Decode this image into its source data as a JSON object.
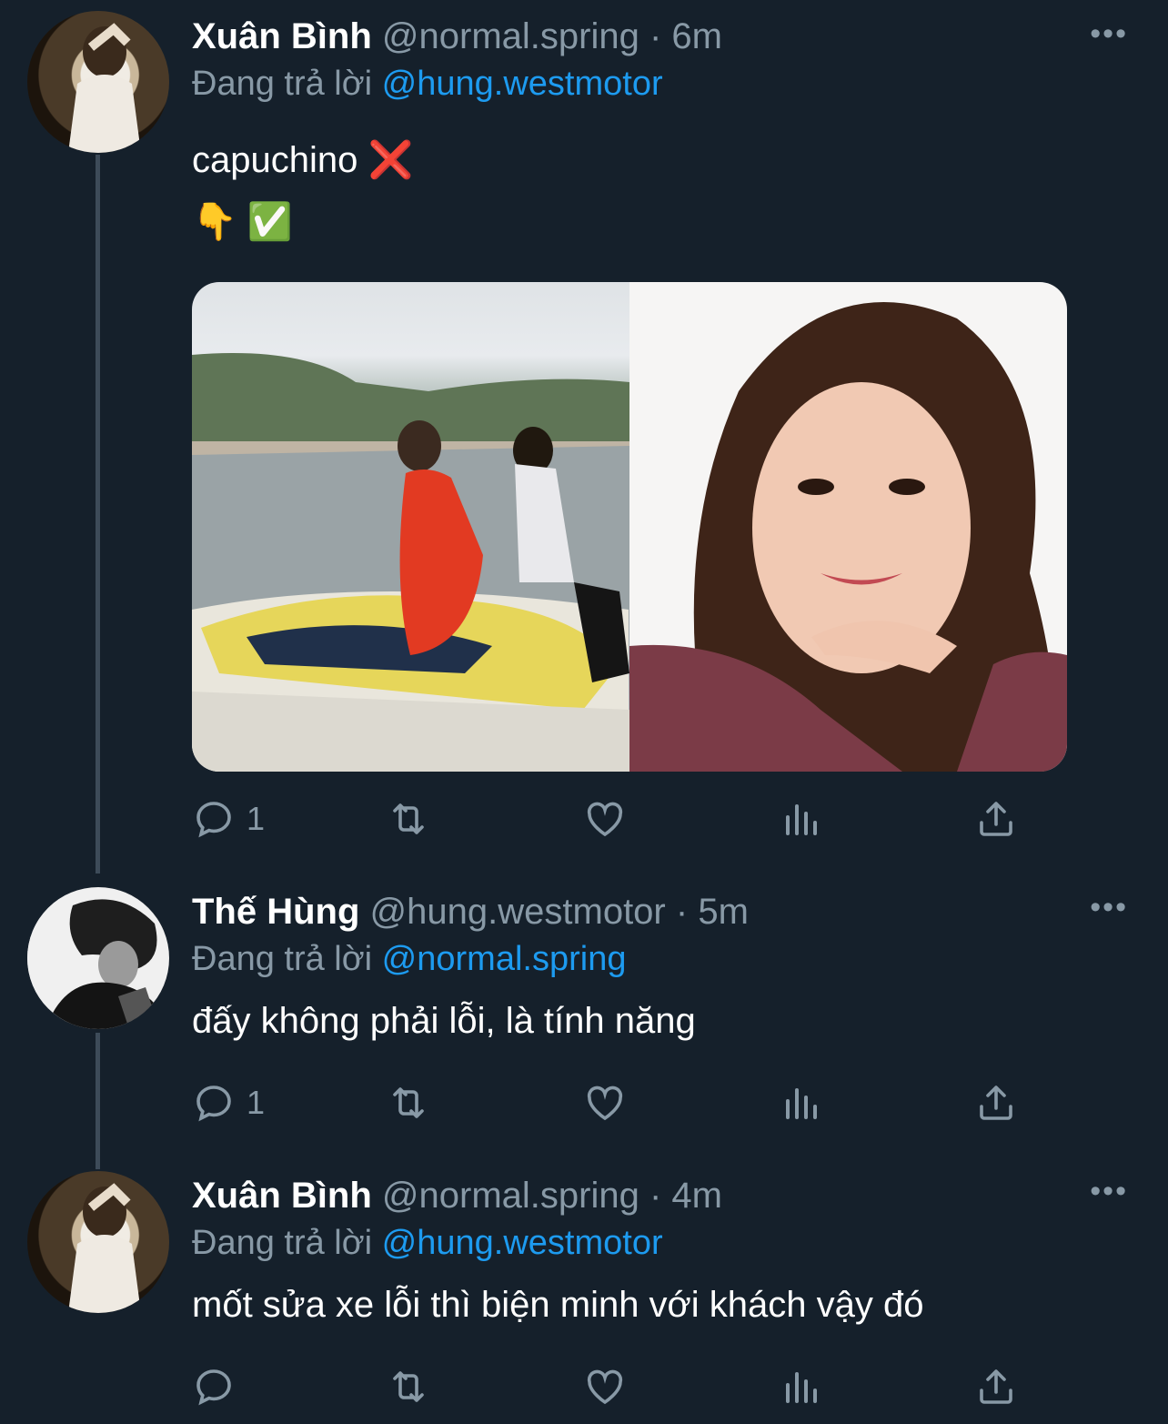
{
  "tweets": [
    {
      "name": "Xuân Bình",
      "handle": "@normal.spring",
      "sep": "·",
      "time": "6m",
      "replying_prefix": "Đang trả lời",
      "replying_to": "@hung.westmotor",
      "text_lines": [
        "capuchino ❌",
        "👇 ✅"
      ],
      "reply_count": "1",
      "more": "•••",
      "avatar": "avatar-man-white-shirt",
      "media": [
        "photo-jetski-two-people-beach",
        "photo-woman-portrait"
      ]
    },
    {
      "name": "Thế Hùng",
      "handle": "@hung.westmotor",
      "sep": "·",
      "time": "5m",
      "replying_prefix": "Đang trả lời",
      "replying_to": "@normal.spring",
      "text": "đấy không phải lỗi, là tính năng",
      "reply_count": "1",
      "more": "•••",
      "avatar": "avatar-man-bw"
    },
    {
      "name": "Xuân Bình",
      "handle": "@normal.spring",
      "sep": "·",
      "time": "4m",
      "replying_prefix": "Đang trả lời",
      "replying_to": "@hung.westmotor",
      "text": "mốt sửa xe lỗi thì biện minh với khách vậy đó",
      "reply_count": "",
      "more": "•••",
      "avatar": "avatar-man-white-shirt"
    }
  ],
  "colors": {
    "background": "#15202b",
    "muted": "#8899a6",
    "link": "#1d9bf0",
    "thread_line": "#3d4b59"
  },
  "icons": [
    "reply-icon",
    "retweet-icon",
    "like-icon",
    "analytics-icon",
    "share-icon",
    "more-icon"
  ]
}
